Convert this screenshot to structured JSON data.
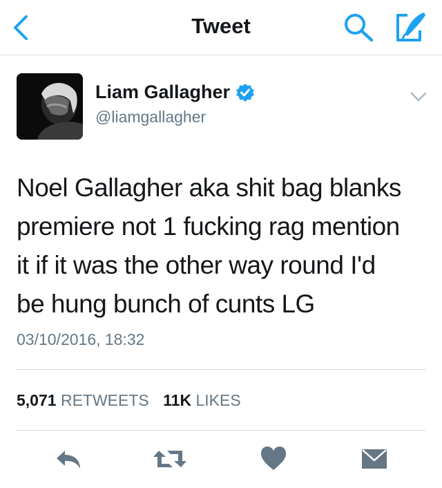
{
  "nav": {
    "title": "Tweet",
    "icons": {
      "back": "chevron-left-icon",
      "search": "search-icon",
      "compose": "compose-icon"
    },
    "accent": "#1da1f2"
  },
  "user": {
    "name": "Liam Gallagher",
    "handle": "@liamgallagher",
    "verified_color": "#1da1f2"
  },
  "tweet": {
    "text_lines": [
      "Noel Gallagher aka shit bag blanks",
      "premiere not 1 fucking rag mention",
      "it if it was the other way round I'd",
      "be hung bunch of cunts LG"
    ],
    "timestamp": "03/10/2016, 18:32"
  },
  "stats": {
    "retweets_count": "5,071",
    "retweets_label": "RETWEETS",
    "likes_count": "11K",
    "likes_label": "LIKES"
  },
  "actions": {
    "icons": [
      "reply-icon",
      "retweet-icon",
      "heart-icon",
      "envelope-icon"
    ],
    "color": "#657786"
  }
}
